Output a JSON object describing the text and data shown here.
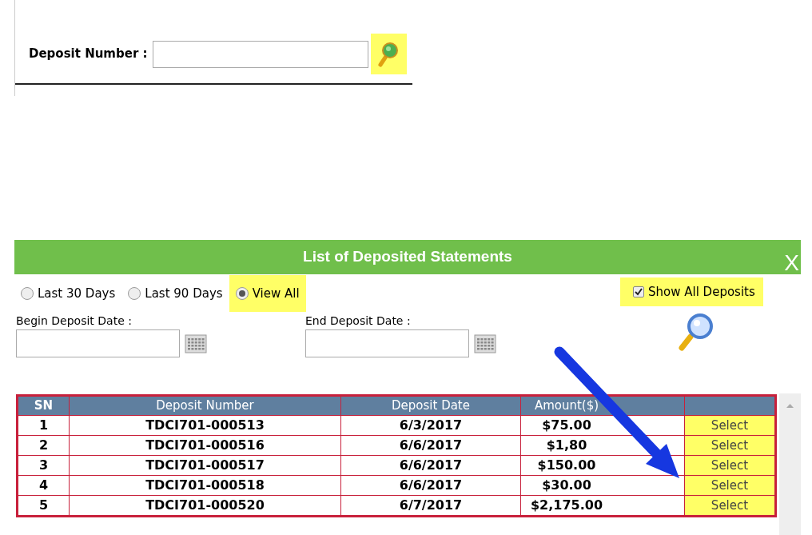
{
  "search": {
    "label": "Deposit Number :"
  },
  "panel": {
    "title": "List of Deposited Statements",
    "close": "X",
    "ranges": [
      {
        "label": "Last 30 Days",
        "selected": false,
        "highlighted": false
      },
      {
        "label": "Last 90 Days",
        "selected": false,
        "highlighted": false
      },
      {
        "label": "View All",
        "selected": true,
        "highlighted": true
      }
    ],
    "show_all": {
      "label": "Show All Deposits",
      "checked": true,
      "highlighted": true
    },
    "begin_label": "Begin Deposit Date :",
    "end_label": "End Deposit Date :"
  },
  "table": {
    "columns": [
      "SN",
      "Deposit Number",
      "Deposit Date",
      "Amount($)",
      ""
    ],
    "rows": [
      {
        "sn": "1",
        "number": "TDCI701-000513",
        "date": "6/3/2017",
        "amount": "$75.00",
        "action": "Select"
      },
      {
        "sn": "2",
        "number": "TDCI701-000516",
        "date": "6/6/2017",
        "amount": "$1,80",
        "action": "Select"
      },
      {
        "sn": "3",
        "number": "TDCI701-000517",
        "date": "6/6/2017",
        "amount": "$150.00",
        "action": "Select"
      },
      {
        "sn": "4",
        "number": "TDCI701-000518",
        "date": "6/6/2017",
        "amount": "$30.00",
        "action": "Select"
      },
      {
        "sn": "5",
        "number": "TDCI701-000520",
        "date": "6/7/2017",
        "amount": "$2,175.00",
        "action": "Select"
      }
    ]
  }
}
